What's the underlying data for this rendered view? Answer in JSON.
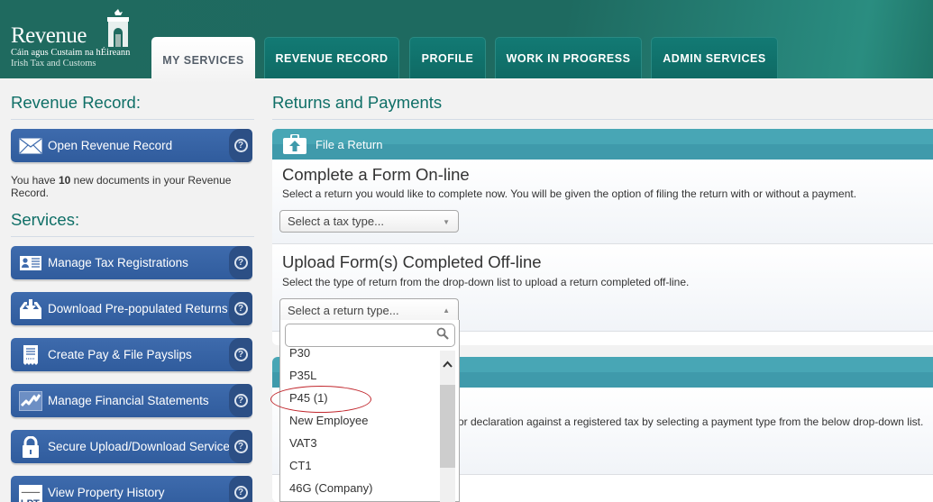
{
  "brand": {
    "name": "Revenue",
    "irish_subtitle": "Cáin agus Custaim na hÉireann",
    "english_subtitle": "Irish Tax and Customs"
  },
  "nav": {
    "tabs": [
      {
        "label": "MY SERVICES",
        "active": true
      },
      {
        "label": "REVENUE RECORD",
        "active": false
      },
      {
        "label": "PROFILE",
        "active": false
      },
      {
        "label": "WORK IN PROGRESS",
        "active": false
      },
      {
        "label": "ADMIN SERVICES",
        "active": false
      }
    ]
  },
  "sidebar": {
    "record_title": "Revenue Record:",
    "open_record_label": "Open Revenue Record",
    "docs_note_prefix": "You have ",
    "docs_count": "10",
    "docs_note_suffix": " new documents in your Revenue Record.",
    "services_title": "Services:",
    "services": [
      {
        "label": "Manage Tax Registrations",
        "icon": "id-card-icon"
      },
      {
        "label": "Download Pre-populated Returns",
        "icon": "download-tray-icon"
      },
      {
        "label": "Create Pay & File Payslips",
        "icon": "receipt-icon"
      },
      {
        "label": "Manage Financial Statements",
        "icon": "line-chart-icon"
      },
      {
        "label": "Secure Upload/Download Service",
        "icon": "padlock-icon"
      },
      {
        "label": "View Property History",
        "icon": "lpt-logo-icon"
      }
    ],
    "help_glyph": "?"
  },
  "main": {
    "title": "Returns and Payments",
    "file_return": {
      "header": "File a Return",
      "online_title": "Complete a Form On-line",
      "online_desc": "Select a return you would like to complete now. You will be given the option of filing the return with or without a payment.",
      "tax_type_placeholder": "Select a tax type...",
      "offline_title": "Upload Form(s) Completed Off-line",
      "offline_desc": "Select the type of return from the drop-down list to upload a return completed off-line.",
      "return_type_placeholder": "Select a return type..."
    },
    "payments": {
      "desc_visible": "or declaration against a registered tax by selecting a payment type from the below drop-down list."
    }
  },
  "dropdown": {
    "search_value": "",
    "options": [
      "P30",
      "P35L",
      "P45 (1)",
      "New Employee",
      "VAT3",
      "CT1",
      "46G (Company)"
    ],
    "highlighted_option": "P45 (1)",
    "annotation_color": "#c1272d"
  },
  "colors": {
    "header_green": "#1f6a5f",
    "tab_teal": "#127a74",
    "heading_teal": "#0f6f67",
    "service_blue": "#3e6bad",
    "panel_head_teal": "#48a6b5"
  }
}
